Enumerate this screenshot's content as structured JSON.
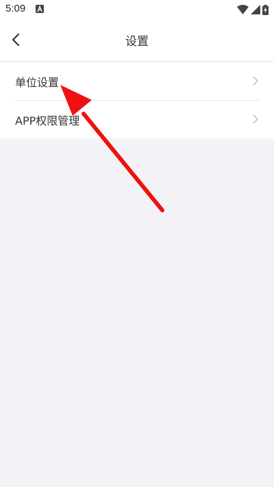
{
  "status_bar": {
    "time": "5:09",
    "icons": [
      "notification-a-icon",
      "wifi-icon",
      "signal-icon",
      "battery-charging-icon"
    ]
  },
  "nav": {
    "title": "设置",
    "back_icon": "chevron-left-icon"
  },
  "settings_list": {
    "items": [
      {
        "label": "单位设置",
        "icon": "chevron-right-icon"
      },
      {
        "label": "APP权限管理",
        "icon": "chevron-right-icon"
      }
    ]
  },
  "colors": {
    "background": "#f2f2f7",
    "surface": "#ffffff",
    "text": "#333333",
    "chevron": "#bbbbbb",
    "annotation": "#ee1111"
  }
}
